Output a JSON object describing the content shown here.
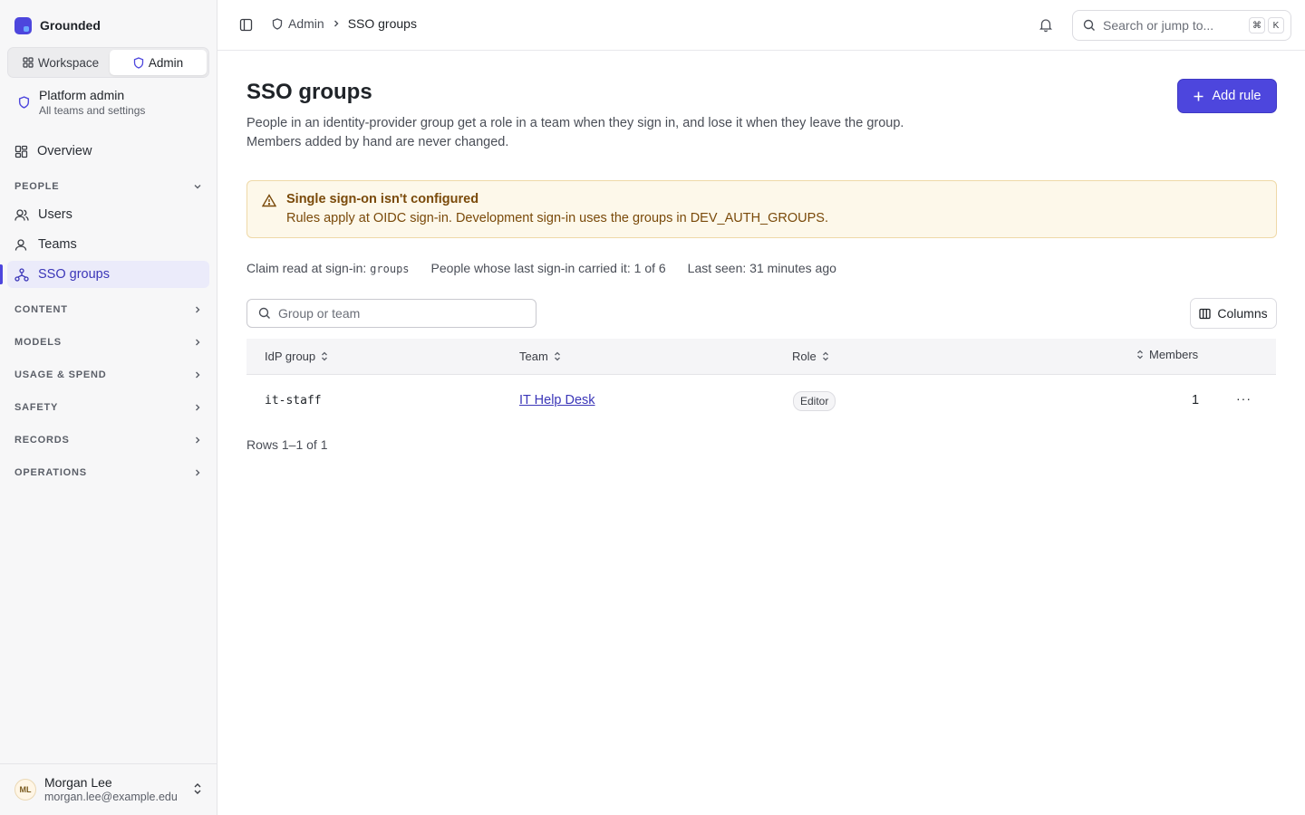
{
  "sidebar": {
    "brand": "Grounded",
    "mode_switch": {
      "workspace": "Workspace",
      "admin": "Admin"
    },
    "scope": {
      "title": "Platform admin",
      "subtitle": "All teams and settings"
    },
    "overview": "Overview",
    "people_section": "PEOPLE",
    "people_items": [
      "Users",
      "Teams",
      "SSO groups"
    ],
    "sections": [
      "CONTENT",
      "MODELS",
      "USAGE & SPEND",
      "SAFETY",
      "RECORDS",
      "OPERATIONS"
    ],
    "user": {
      "initials": "ML",
      "name": "Morgan Lee",
      "email": "morgan.lee@example.edu"
    }
  },
  "topbar": {
    "breadcrumb": [
      "Admin",
      "SSO groups"
    ],
    "search_placeholder": "Search or jump to...",
    "shortcut": [
      "⌘",
      "K"
    ]
  },
  "page": {
    "title": "SSO groups",
    "description_1": "People in an identity-provider group get a role in a team when they sign in, and lose it when they leave the group.",
    "description_2": "Members added by hand are never changed.",
    "add_button": "Add rule"
  },
  "alert": {
    "title": "Single sign-on isn't configured",
    "text": "Rules apply at OIDC sign-in. Development sign-in uses the groups in DEV_AUTH_GROUPS."
  },
  "meta": {
    "claim_label": "Claim read at sign-in:",
    "claim_value": "groups",
    "people_carried": "People whose last sign-in carried it: 1 of 6",
    "last_seen": "Last seen: 31 minutes ago"
  },
  "filter": {
    "placeholder": "Group or team"
  },
  "columns_button": "Columns",
  "table": {
    "headers": [
      "IdP group",
      "Team",
      "Role",
      "Members"
    ],
    "rows": [
      {
        "group": "it-staff",
        "team": "IT Help Desk",
        "role": "Editor",
        "members": "1",
        "menu": "···"
      }
    ],
    "footer": "Rows 1–1 of 1"
  },
  "colors": {
    "accent": "#4d46dd",
    "alert_bg": "#fdf8ea",
    "alert_text": "#7a4a0a"
  }
}
